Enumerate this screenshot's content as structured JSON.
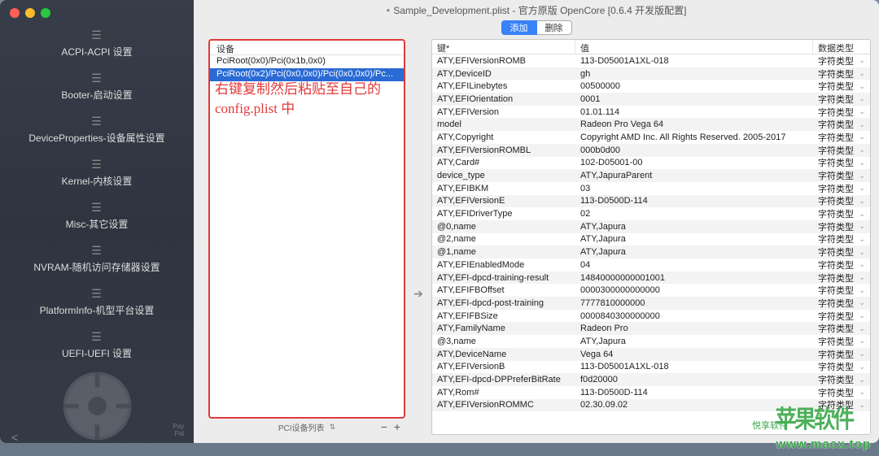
{
  "window": {
    "title": "Sample_Development.plist - 官方原版 OpenCore [0.6.4 开发版配置]"
  },
  "toolbar": {
    "add": "添加",
    "delete": "删除"
  },
  "sidebar": {
    "items": [
      {
        "label": "ACPI-ACPI 设置"
      },
      {
        "label": "Booter-启动设置"
      },
      {
        "label": "DeviceProperties-设备属性设置"
      },
      {
        "label": "Kernel-内核设置"
      },
      {
        "label": "Misc-其它设置"
      },
      {
        "label": "NVRAM-随机访问存储器设置"
      },
      {
        "label": "PlatformInfo-机型平台设置"
      },
      {
        "label": "UEFI-UEFI 设置"
      }
    ],
    "small1": "Pay",
    "small2": "Pal"
  },
  "devices": {
    "header": "设备",
    "rows": [
      "PciRoot(0x0)/Pci(0x1b,0x0)",
      "PciRoot(0x2)/Pci(0x0,0x0)/Pci(0x0,0x0)/Pc..."
    ],
    "annotation": "右键复制然后粘贴至自己的 config.plist 中",
    "footer_label": "PCI设备列表"
  },
  "table": {
    "headers": {
      "key": "键*",
      "value": "值",
      "type": "数据类型"
    },
    "type_label": "字符类型",
    "rows": [
      {
        "k": "ATY,EFIVersionROMB",
        "v": "113-D05001A1XL-018"
      },
      {
        "k": "ATY,DeviceID",
        "v": "gh"
      },
      {
        "k": "ATY,EFILinebytes",
        "v": "00500000"
      },
      {
        "k": "ATY,EFIOrientation",
        "v": "0001"
      },
      {
        "k": "ATY,EFIVersion",
        "v": "01.01.114"
      },
      {
        "k": "model",
        "v": "Radeon Pro Vega 64"
      },
      {
        "k": "ATY,Copyright",
        "v": "Copyright AMD Inc. All Rights Reserved. 2005-2017"
      },
      {
        "k": "ATY,EFIVersionROMBL",
        "v": "000b0d00"
      },
      {
        "k": "ATY,Card#",
        "v": "102-D05001-00"
      },
      {
        "k": "device_type",
        "v": "ATY,JapuraParent"
      },
      {
        "k": "ATY,EFIBKM",
        "v": "03"
      },
      {
        "k": "ATY,EFIVersionE",
        "v": "113-D0500D-114"
      },
      {
        "k": "ATY,EFIDriverType",
        "v": "02"
      },
      {
        "k": "@0,name",
        "v": "ATY,Japura"
      },
      {
        "k": "@2,name",
        "v": "ATY,Japura"
      },
      {
        "k": "@1,name",
        "v": "ATY,Japura"
      },
      {
        "k": "ATY,EFIEnabledMode",
        "v": "04"
      },
      {
        "k": "ATY,EFI-dpcd-training-result",
        "v": "14840000000001001"
      },
      {
        "k": "ATY,EFIFBOffset",
        "v": "0000300000000000"
      },
      {
        "k": "ATY,EFI-dpcd-post-training",
        "v": "7777810000000"
      },
      {
        "k": "ATY,EFIFBSize",
        "v": "0000840300000000"
      },
      {
        "k": "ATY,FamilyName",
        "v": "Radeon Pro"
      },
      {
        "k": "@3,name",
        "v": "ATY,Japura"
      },
      {
        "k": "ATY,DeviceName",
        "v": "Vega 64"
      },
      {
        "k": "ATY,EFIVersionB",
        "v": "113-D05001A1XL-018"
      },
      {
        "k": "ATY,EFI-dpcd-DPPreferBitRate",
        "v": "f0d20000"
      },
      {
        "k": "ATY,Rom#",
        "v": "113-D0500D-114"
      },
      {
        "k": "ATY,EFIVersionROMMC",
        "v": "02.30.09.02"
      }
    ]
  },
  "watermark": {
    "logo": "苹果软件",
    "sub": "悦享软件",
    "url": "www.macx.top"
  }
}
